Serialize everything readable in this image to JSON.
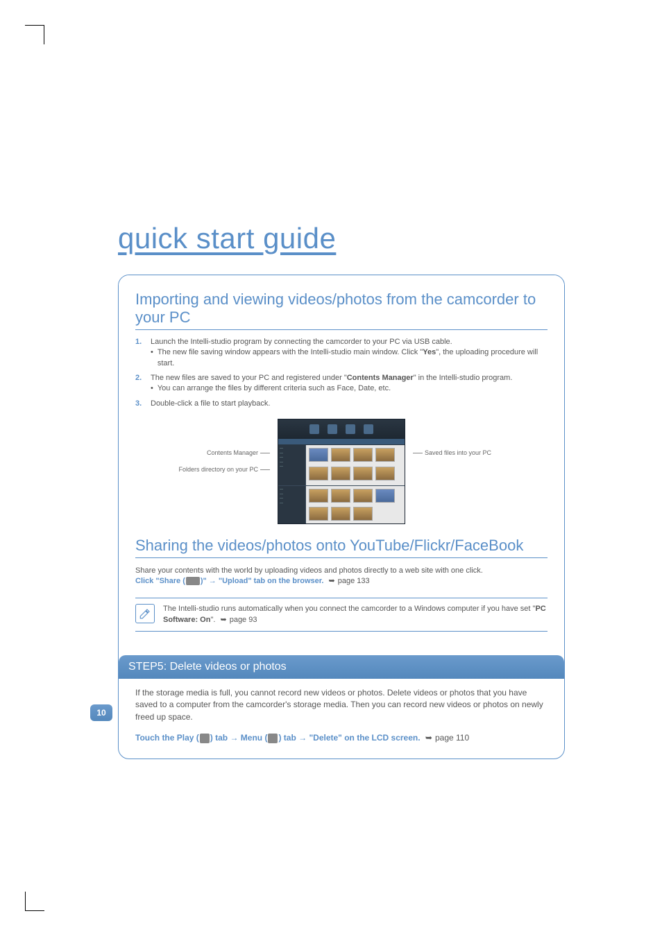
{
  "page_number": "10",
  "chapter_title": "quick start guide",
  "section1": {
    "heading": "Importing and viewing videos/photos from the camcorder to your PC",
    "items": [
      {
        "num": "1.",
        "text": "Launch the Intelli-studio program by connecting the camcorder to your PC via USB cable.",
        "sub": [
          {
            "pre": "The new file saving window appears with the Intelli-studio main window. Click \"",
            "bold": "Yes",
            "post": "\", the uploading procedure will start."
          }
        ]
      },
      {
        "num": "2.",
        "text_pre": "The new files are saved to your PC and registered under \"",
        "text_bold": "Contents Manager",
        "text_post": "\" in the Intelli-studio program.",
        "sub": [
          {
            "pre": "You can arrange the files by different criteria such as Face, Date, etc.",
            "bold": "",
            "post": ""
          }
        ]
      },
      {
        "num": "3.",
        "text": "Double-click a file to start playback."
      }
    ],
    "figure": {
      "left_labels": [
        "Contents Manager",
        "Folders directory on your PC"
      ],
      "right_label": "Saved files into your PC"
    }
  },
  "section2": {
    "heading": "Sharing the videos/photos onto YouTube/Flickr/FaceBook",
    "body": "Share your contents with the world by uploading videos and photos directly to a web site with one click.",
    "instr_pre": "Click \"Share (",
    "instr_mid": ")\" → \"Upload\" tab on the browser.",
    "instr_page": "page 133",
    "note_pre": "The Intelli-studio runs automatically when you connect the camcorder to a Windows computer if you have set \"",
    "note_bold": "PC Software: On",
    "note_post": "\".",
    "note_page": "page 93"
  },
  "step5": {
    "header": "STEP5: Delete videos or photos",
    "body": "If the storage media is full, you cannot record new videos or photos. Delete videos or photos that you have saved to a computer from the camcorder's storage media. Then you can record new videos or photos on newly freed up space.",
    "instr_a": "Touch the Play (",
    "instr_b": ") tab → Menu (",
    "instr_c": ") tab → \"Delete\" on the LCD screen.",
    "instr_page": "page 110"
  }
}
